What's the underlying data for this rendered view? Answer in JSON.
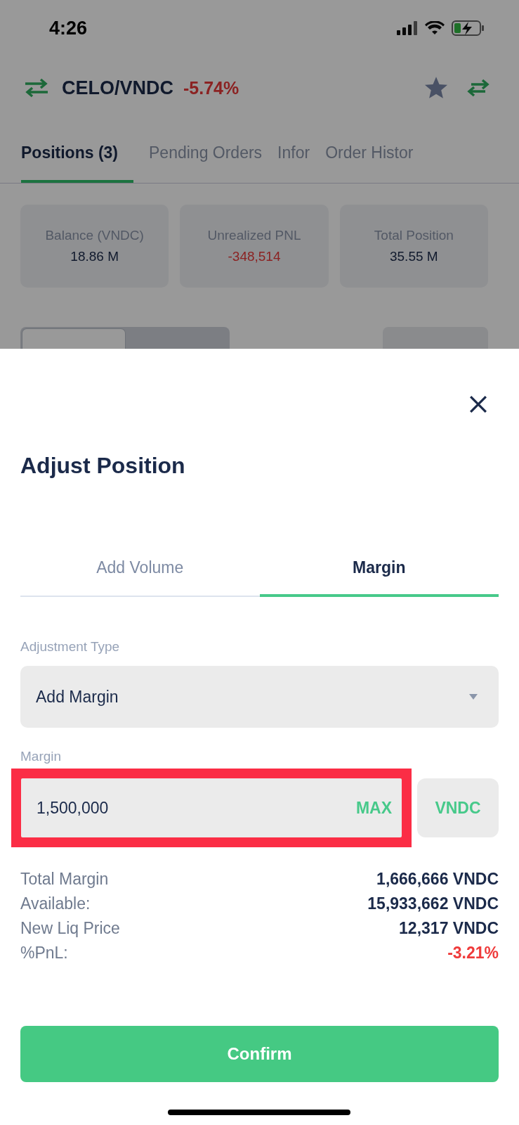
{
  "status_bar": {
    "time": "4:26"
  },
  "header": {
    "pair": "CELO/VNDC",
    "change": "-5.74%",
    "favorite": true
  },
  "tabs": [
    {
      "label": "Positions (3)",
      "selected": true
    },
    {
      "label": "Pending Orders",
      "selected": false
    },
    {
      "label": "Infor",
      "selected": false
    },
    {
      "label": "Order Histor",
      "selected": false
    }
  ],
  "summary_cards": [
    {
      "label": "Balance (VNDC)",
      "value": "18.86 M",
      "negative": false
    },
    {
      "label": "Unrealized PNL",
      "value": "-348,514",
      "negative": true
    },
    {
      "label": "Total Position",
      "value": "35.55 M",
      "negative": false
    }
  ],
  "view_toggle": [
    {
      "selected": true
    },
    {
      "selected": false
    }
  ],
  "sheet": {
    "title": "Adjust Position",
    "tabs": [
      {
        "label": "Add Volume",
        "selected": false
      },
      {
        "label": "Margin",
        "selected": true
      }
    ],
    "adjustment_type": {
      "label": "Adjustment Type",
      "value": "Add Margin"
    },
    "margin": {
      "label": "Margin",
      "value": "1,500,000",
      "max": "MAX",
      "unit": "VNDC",
      "highlighted": true
    },
    "details": [
      {
        "label": "Total Margin",
        "value": "1,666,666 VNDC",
        "negative": false
      },
      {
        "label": "Available:",
        "value": "15,933,662 VNDC",
        "negative": false
      },
      {
        "label": "New Liq Price",
        "value": "12,317 VNDC",
        "negative": false
      },
      {
        "label": "%PnL:",
        "value": "-3.21%",
        "negative": true
      }
    ],
    "confirm": "Confirm"
  }
}
